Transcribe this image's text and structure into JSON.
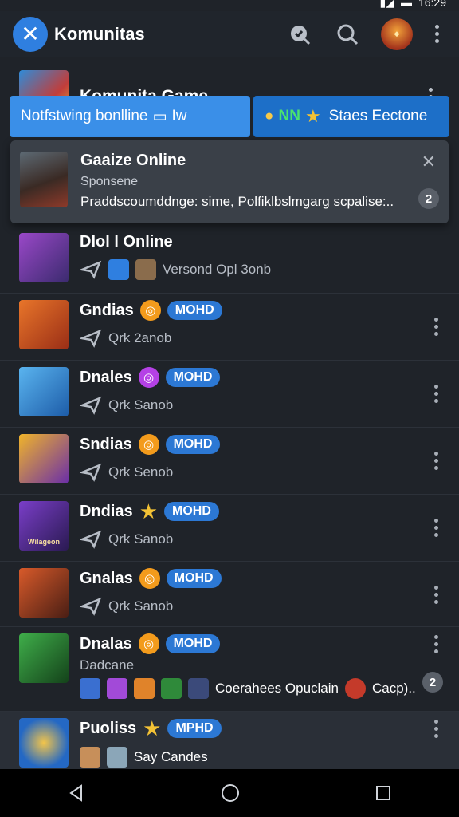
{
  "statusbar": {
    "time": "16:29"
  },
  "appbar": {
    "title": "Komunitas"
  },
  "featured": {
    "title": "Komunita Game",
    "pill_left": "Notfstwing bonlline",
    "pill_left_suffix": "Iw",
    "pill_right_prefix": "NN",
    "pill_right": "Staes Eectone"
  },
  "sponsored": {
    "title": "Gaaize Online",
    "subtitle": "Sponsene",
    "description": "Praddscoumddnge: sime, Polfiklbslmgarg scpalise:..",
    "count": "2"
  },
  "list": [
    {
      "title": "Dlol l Online",
      "badge": "",
      "meta": "Versond Opl 3onb",
      "color": "#8e3fb7"
    },
    {
      "title": "Gndias",
      "badge": "MOHD",
      "meta": "Qrk 2anob",
      "color": "#c8521b",
      "emblem": "coin"
    },
    {
      "title": "Dnales",
      "badge": "MOHD",
      "meta": "Qrk Sanob",
      "color": "#2a7fd0",
      "emblem": "coin-purple"
    },
    {
      "title": "Sndias",
      "badge": "MOHD",
      "meta": "Qrk Senob",
      "color": "#d08a1f",
      "emblem": "coin"
    },
    {
      "title": "Dndias",
      "badge": "MOHD",
      "meta": "Qrk Sanob",
      "color": "#6a3cb0",
      "emblem": "star",
      "thumb_text": "Wilageon"
    },
    {
      "title": "Gnalas",
      "badge": "MOHD",
      "meta": "Qrk Sanob",
      "color": "#b8461d",
      "emblem": "coin"
    },
    {
      "title": "Dnalas",
      "badge": "MOHD",
      "meta": "Dadcane",
      "meta2": "Coerahees Opuclain",
      "meta3": "Cacp)..",
      "count": "2",
      "color": "#2d8a3a",
      "emblem": "coin"
    },
    {
      "title": "Puoliss",
      "badge": "MPHD",
      "meta": "Say Candes",
      "color": "#2468c4",
      "emblem": "star"
    }
  ]
}
